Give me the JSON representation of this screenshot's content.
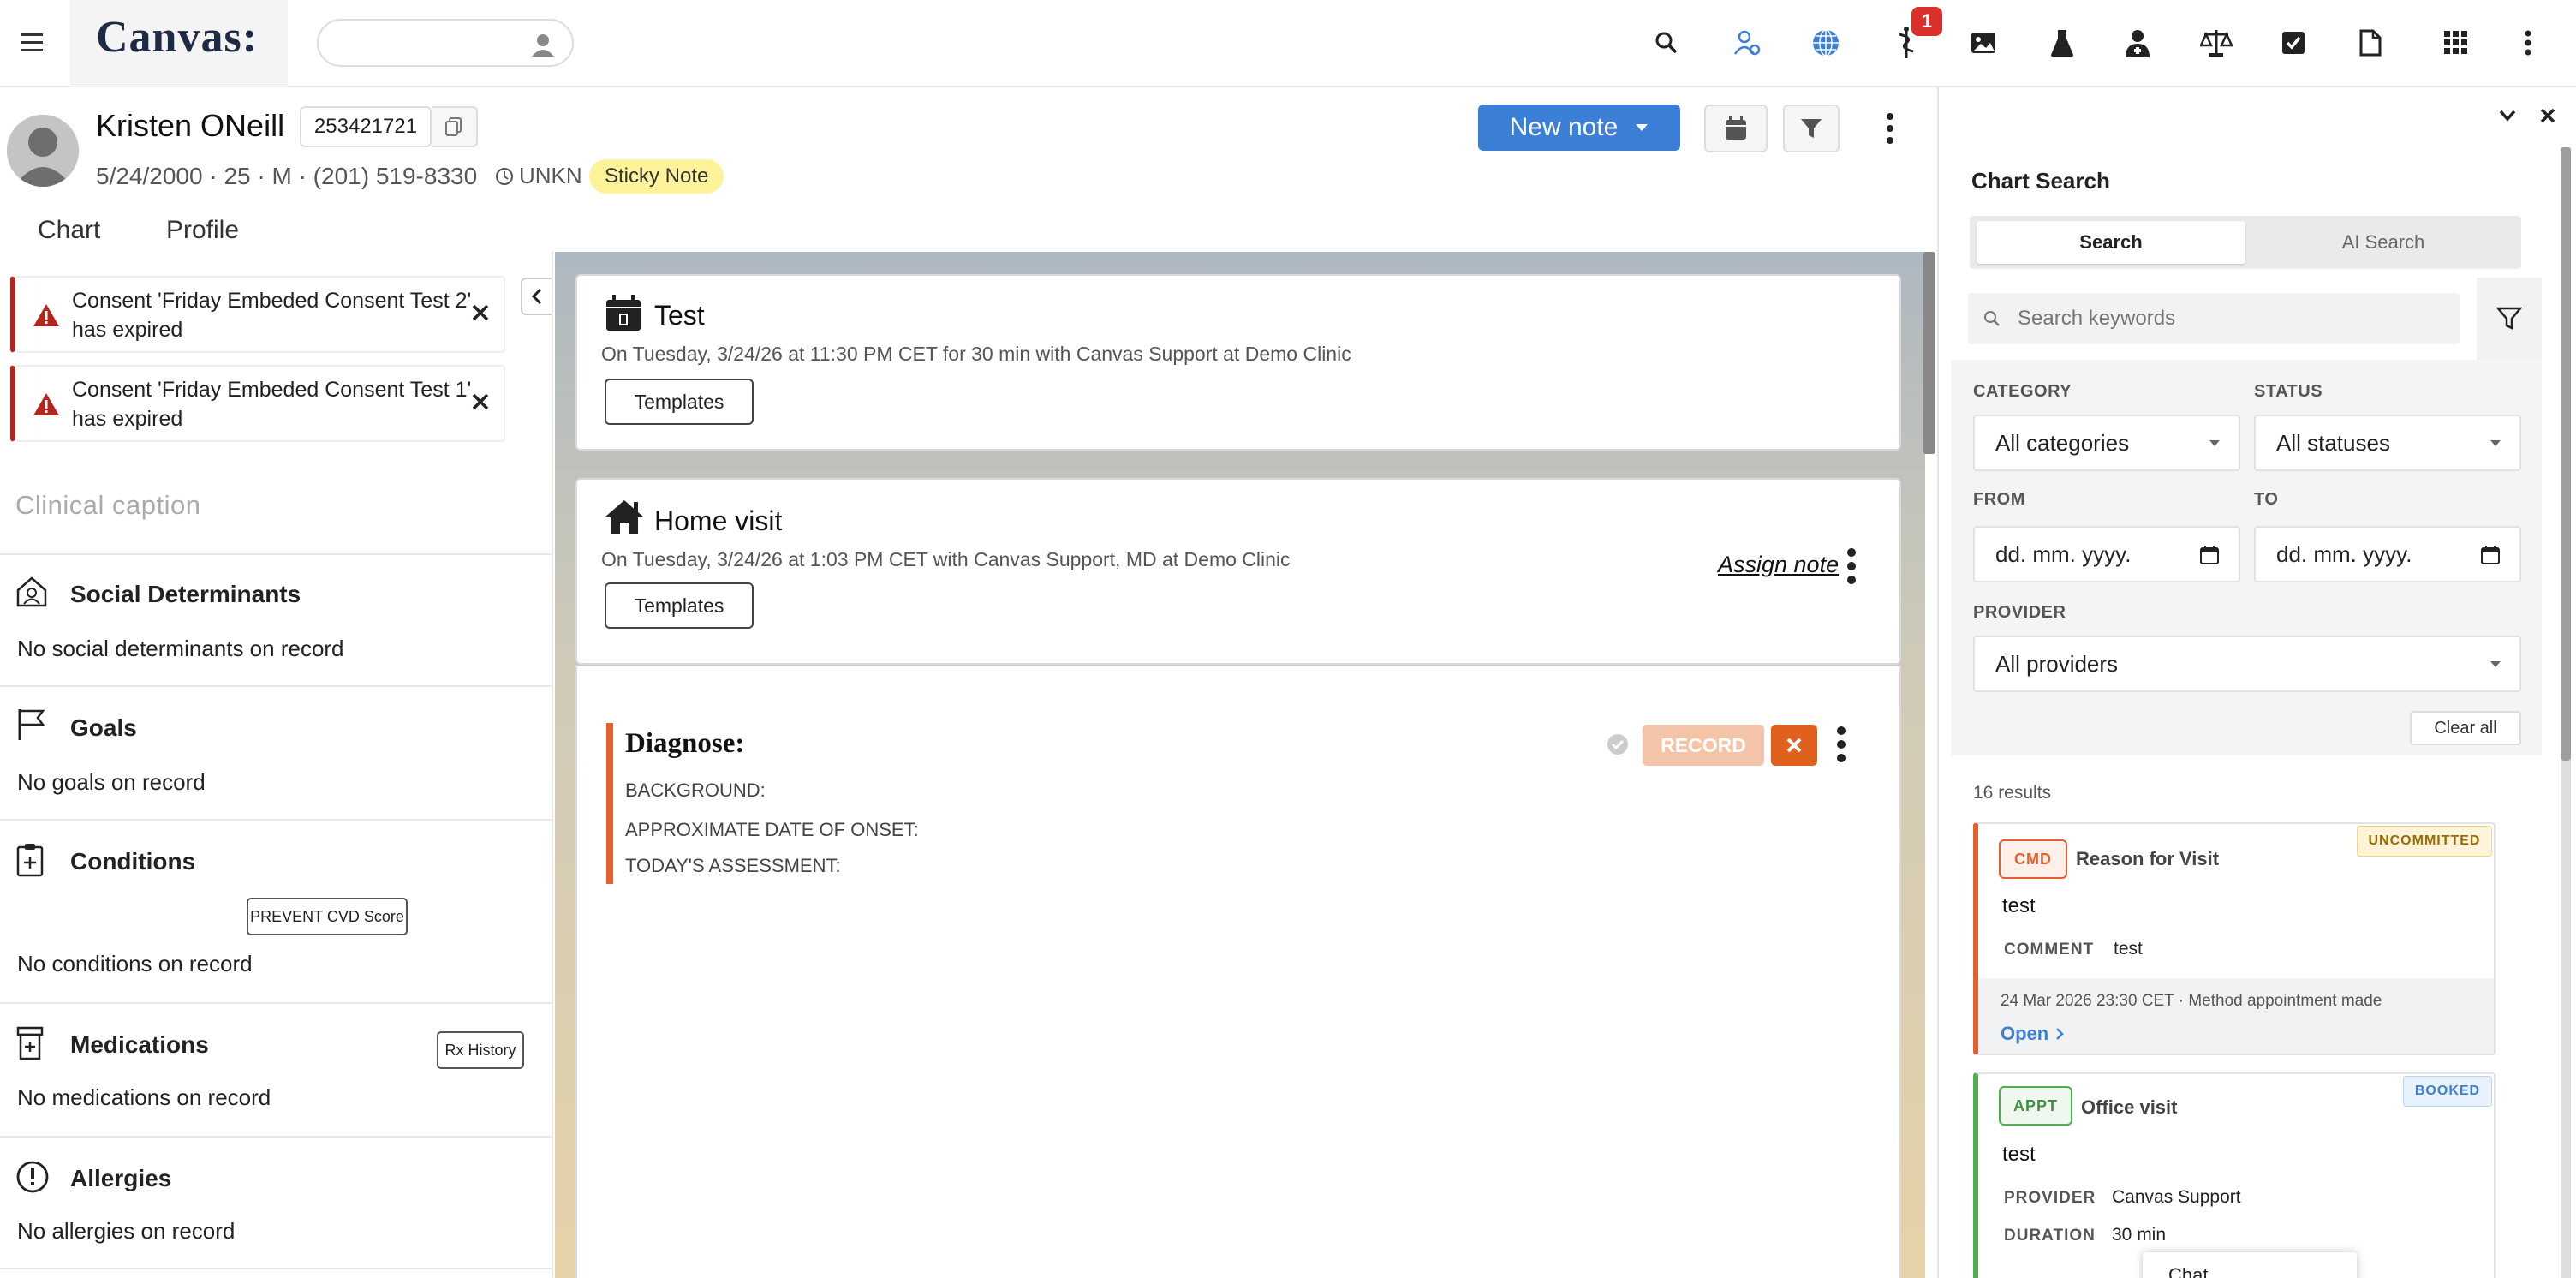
{
  "app": {
    "logo": "Canvas:",
    "notification_count": "1"
  },
  "top_icons": [
    "search-icon",
    "patient-lookup-icon",
    "globe-icon",
    "caduceus-icon",
    "image-icon",
    "lab-flask-icon",
    "doctor-icon",
    "scales-icon",
    "checkbox-icon",
    "document-icon",
    "apps-grid-icon",
    "more-vertical-icon"
  ],
  "patient": {
    "name": "Kristen ONeill",
    "id": "253421721",
    "demographics": "5/24/2000 · 25 · M · (201) 519-8330",
    "timezone": "UNKN",
    "sticky_note": "Sticky Note"
  },
  "tabs": {
    "chart": "Chart",
    "profile": "Profile"
  },
  "toolbar": {
    "new_note": "New note"
  },
  "alerts": [
    {
      "text": "Consent 'Friday Embeded Consent Test 2' has expired"
    },
    {
      "text": "Consent 'Friday Embeded Consent Test 1' has expired"
    }
  ],
  "sidebar": {
    "caption_placeholder": "Clinical caption",
    "sections": {
      "social": {
        "title": "Social Determinants",
        "empty": "No social determinants on record"
      },
      "goals": {
        "title": "Goals",
        "empty": "No goals on record"
      },
      "conditions": {
        "title": "Conditions",
        "empty": "No conditions on record",
        "button": "PREVENT CVD Score"
      },
      "medications": {
        "title": "Medications",
        "empty": "No medications on record",
        "button": "Rx History"
      },
      "allergies": {
        "title": "Allergies",
        "empty": "No allergies on record"
      }
    }
  },
  "notes": {
    "test": {
      "title": "Test",
      "subtitle": "On Tuesday, 3/24/26 at 11:30 PM CET for 30 min with Canvas Support at Demo Clinic",
      "templates": "Templates"
    },
    "home": {
      "title": "Home visit",
      "subtitle": "On Tuesday, 3/24/26 at 1:03 PM CET with Canvas Support, MD at Demo Clinic",
      "templates": "Templates",
      "assign": "Assign note"
    },
    "diagnose": {
      "title": "Diagnose:",
      "fields": [
        "BACKGROUND:",
        "APPROXIMATE DATE OF ONSET:",
        "TODAY'S ASSESSMENT:"
      ],
      "record": "RECORD"
    }
  },
  "chart_search": {
    "title": "Chart Search",
    "tabs": {
      "search": "Search",
      "ai": "AI Search"
    },
    "keyword_placeholder": "Search keywords",
    "labels": {
      "category": "CATEGORY",
      "status": "STATUS",
      "from": "FROM",
      "to": "TO",
      "provider": "PROVIDER"
    },
    "values": {
      "category": "All categories",
      "status": "All statuses",
      "from": "dd. mm. yyyy.",
      "to": "dd. mm. yyyy.",
      "provider": "All providers"
    },
    "clear_all": "Clear all",
    "results_count": "16 results",
    "results": [
      {
        "tag": "CMD",
        "title": "Reason for Visit",
        "status": "UNCOMMITTED",
        "body": "test",
        "fields": [
          {
            "key": "COMMENT",
            "value": "test"
          }
        ],
        "meta": "24 Mar 2026 23:30 CET · Method appointment made",
        "open": "Open",
        "accent": "#e4612f"
      },
      {
        "tag": "APPT",
        "title": "Office visit",
        "status": "BOOKED",
        "body": "test",
        "fields": [
          {
            "key": "PROVIDER",
            "value": "Canvas Support"
          },
          {
            "key": "DURATION",
            "value": "30 min"
          }
        ],
        "accent": "#4caf50"
      }
    ],
    "popover": "Chat"
  },
  "colors": {
    "primary": "#3c7fd6",
    "alert": "#b3261e",
    "record": "#e4612f",
    "sticky": "#fff39a"
  }
}
